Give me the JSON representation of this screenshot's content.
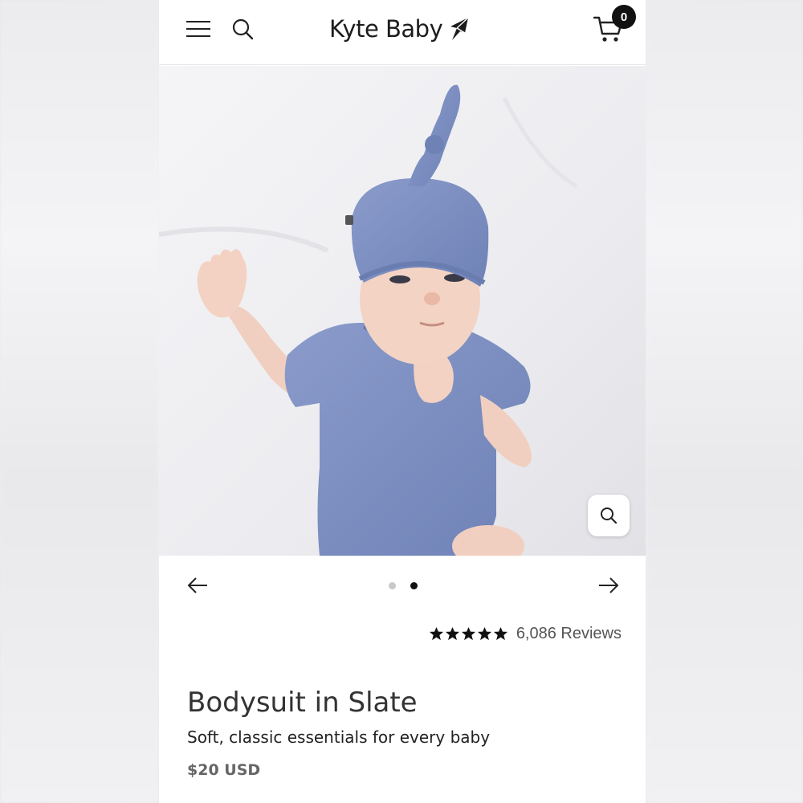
{
  "header": {
    "logo_text": "Kyte Baby",
    "cart_count": "0"
  },
  "icons": {
    "menu": "hamburger-menu-icon",
    "search": "search-icon",
    "cart": "shopping-cart-icon",
    "zoom": "magnifier-zoom-icon",
    "prev": "arrow-left-icon",
    "next": "arrow-right-icon",
    "star": "star-icon"
  },
  "carousel": {
    "total_slides": 2,
    "active_index": 1
  },
  "product": {
    "rating": 5,
    "reviews_label": "6,086 Reviews",
    "title": "Bodysuit in Slate",
    "subtitle": "Soft, classic essentials for every baby",
    "price": "$20 USD"
  },
  "colors": {
    "slate": "#7d8fc0",
    "text_dark": "#222222",
    "badge": "#111111"
  }
}
